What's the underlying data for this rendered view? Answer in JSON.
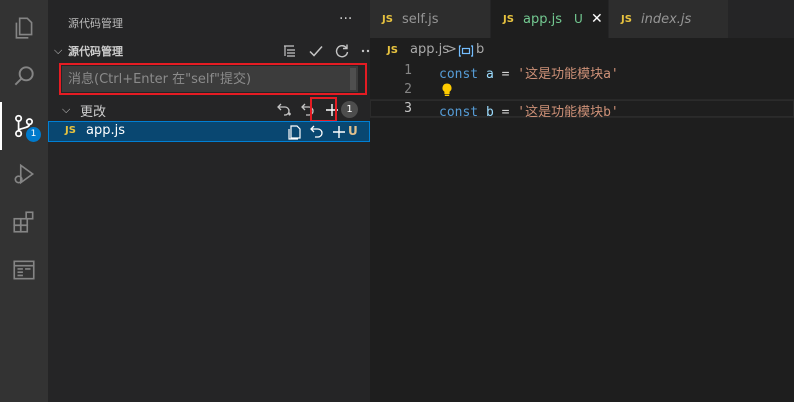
{
  "colors": {
    "accent": "#007acc",
    "highlight_box": "#e51c23",
    "js_badge": "#e8c33f",
    "untracked": "#73c991"
  },
  "activity_bar": {
    "items": [
      {
        "name": "explorer",
        "icon": "files-icon"
      },
      {
        "name": "search",
        "icon": "search-icon"
      },
      {
        "name": "source-control",
        "icon": "source-control-icon",
        "badge": "1"
      },
      {
        "name": "run-debug",
        "icon": "debug-icon"
      },
      {
        "name": "extensions",
        "icon": "extensions-icon"
      },
      {
        "name": "remote-explorer",
        "icon": "window-icon"
      }
    ]
  },
  "sidebar": {
    "title": "源代码管理",
    "more": "···",
    "section": {
      "label": "源代码管理",
      "actions": [
        "list-tree-icon",
        "check-icon",
        "refresh-icon",
        "more-icon"
      ]
    },
    "message": {
      "placeholder": "消息(Ctrl+Enter 在\"self\"提交)"
    },
    "changes": {
      "label": "更改",
      "count": "1",
      "actions": [
        "discard-all-icon",
        "undo-icon",
        "stage-all-icon"
      ]
    },
    "files": [
      {
        "type": "JS",
        "name": "app.js",
        "status": "U",
        "actions": [
          "open-file-icon",
          "discard-icon",
          "stage-icon"
        ]
      }
    ]
  },
  "editor": {
    "tabs": [
      {
        "type": "JS",
        "label": "self.js",
        "active": false
      },
      {
        "type": "JS",
        "label": "app.js",
        "active": true,
        "status": "U",
        "close": "✕"
      },
      {
        "type": "JS",
        "label": "index.js",
        "active": false,
        "preview": true
      }
    ],
    "breadcrumb": {
      "type": "JS",
      "file": "app.js",
      "separator": ">",
      "symbol": "b"
    },
    "lines": [
      {
        "number": "1",
        "keyword": "const",
        "name": "a",
        "op": "=",
        "value": "'这是功能模块a'"
      },
      {
        "number": "2"
      },
      {
        "number": "3",
        "keyword": "const",
        "name": "b",
        "op": "=",
        "value": "'这是功能模块b'"
      }
    ]
  }
}
